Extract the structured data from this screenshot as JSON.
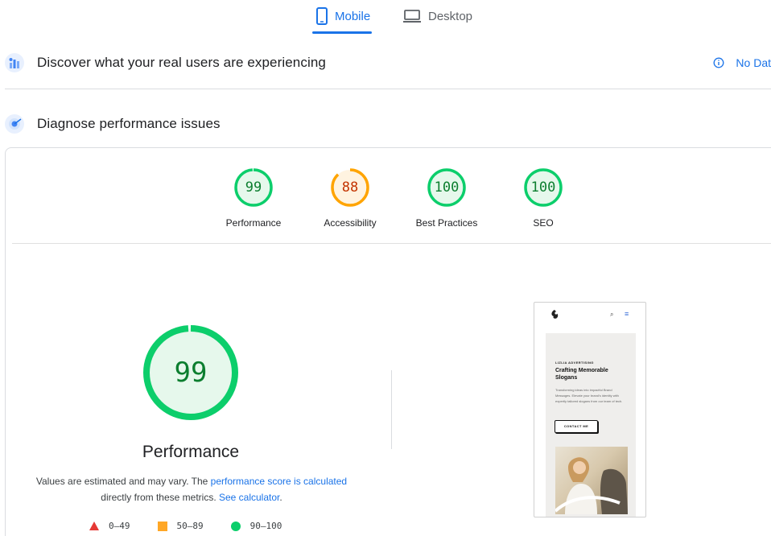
{
  "tabs": [
    {
      "label": "Mobile",
      "icon": "smartphone-icon",
      "active": true
    },
    {
      "label": "Desktop",
      "icon": "laptop-icon",
      "active": false
    }
  ],
  "sections": {
    "field_data": {
      "title": "Discover what your real users are experiencing",
      "icon": "users-chart-icon",
      "status": "No Dat"
    },
    "diagnose": {
      "title": "Diagnose performance issues",
      "icon": "lighthouse-icon"
    }
  },
  "scores": [
    {
      "label": "Performance",
      "value": "99",
      "rating": "pass"
    },
    {
      "label": "Accessibility",
      "value": "88",
      "rating": "average"
    },
    {
      "label": "Best Practices",
      "value": "100",
      "rating": "pass"
    },
    {
      "label": "SEO",
      "value": "100",
      "rating": "pass"
    }
  ],
  "performance": {
    "score": "99",
    "title": "Performance",
    "note_prefix": "Values are estimated and may vary. The ",
    "note_link": "performance score is calculated",
    "note_middle": " directly from these metrics. ",
    "note_link2": "See calculator",
    "note_suffix": "."
  },
  "legend": [
    {
      "range": "0–49",
      "shape": "triangle",
      "color": "#e53935"
    },
    {
      "range": "50–89",
      "shape": "square",
      "color": "#ffa726"
    },
    {
      "range": "90–100",
      "shape": "circle",
      "color": "#0cce6b"
    }
  ],
  "thumbnail": {
    "eyebrow": "LIZLIA ADVERTISING",
    "headline": "Crafting Memorable Slogans",
    "description": "Transforming ideas into impactful Brand Messages. Elevate your brand's identity with expertly tailored slogans from our team of tech.",
    "button": "CONTACT ME"
  },
  "colors": {
    "accent": "#1a73e8",
    "pass": "#0cce6b",
    "pass_text": "#0c7e2f",
    "average": "#ffa400",
    "average_text": "#c33300",
    "pass_fill": "#e6f8ec",
    "average_fill": "#fff3e0"
  }
}
